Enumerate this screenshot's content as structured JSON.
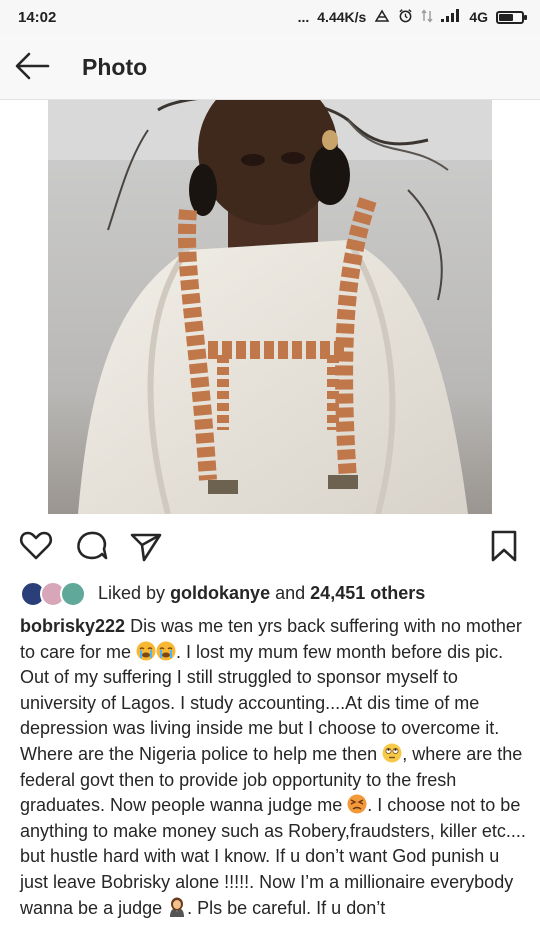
{
  "status_bar": {
    "time": "14:02",
    "dots": "...",
    "speed": "4.44K/s",
    "network": "4G",
    "icons": [
      "data-saver-icon",
      "alarm-icon",
      "data-transfer-icon",
      "signal-icon",
      "battery-icon"
    ]
  },
  "header": {
    "title": "Photo",
    "back_icon": "back-arrow-icon"
  },
  "actions": {
    "icons": [
      "heart-icon",
      "comment-icon",
      "share-icon",
      "bookmark-icon"
    ]
  },
  "likes": {
    "prefix": "Liked by",
    "user": "goldokanye",
    "conj": "and",
    "count": "24,451 others"
  },
  "caption": {
    "username": "bobrisky222",
    "seg1": " Dis was me ten yrs back suffering with no mother to care for me ",
    "seg2": ". I lost my mum few month before dis pic. Out of my suffering I still struggled to sponsor myself to university of Lagos. I study accounting....At dis time of me depression was living inside me but I choose to overcome it. Where are the Nigeria police to help me then ",
    "seg3": ", where are  the federal govt then to provide job opportunity to the fresh graduates. Now people wanna judge me ",
    "seg4": ". I choose not to be anything to make money such as Robery,fraudsters, killer etc.... but hustle hard with wat I know. If u don’t want God punish u just leave Bobrisky alone !!!!!. Now I’m a millionaire everybody wanna be a judge ",
    "seg5": ". Pls be careful. If u don’t"
  },
  "colors": {
    "text": "#262626",
    "header_bg": "#f8f8f8",
    "status_bg": "#f7f7f7"
  }
}
